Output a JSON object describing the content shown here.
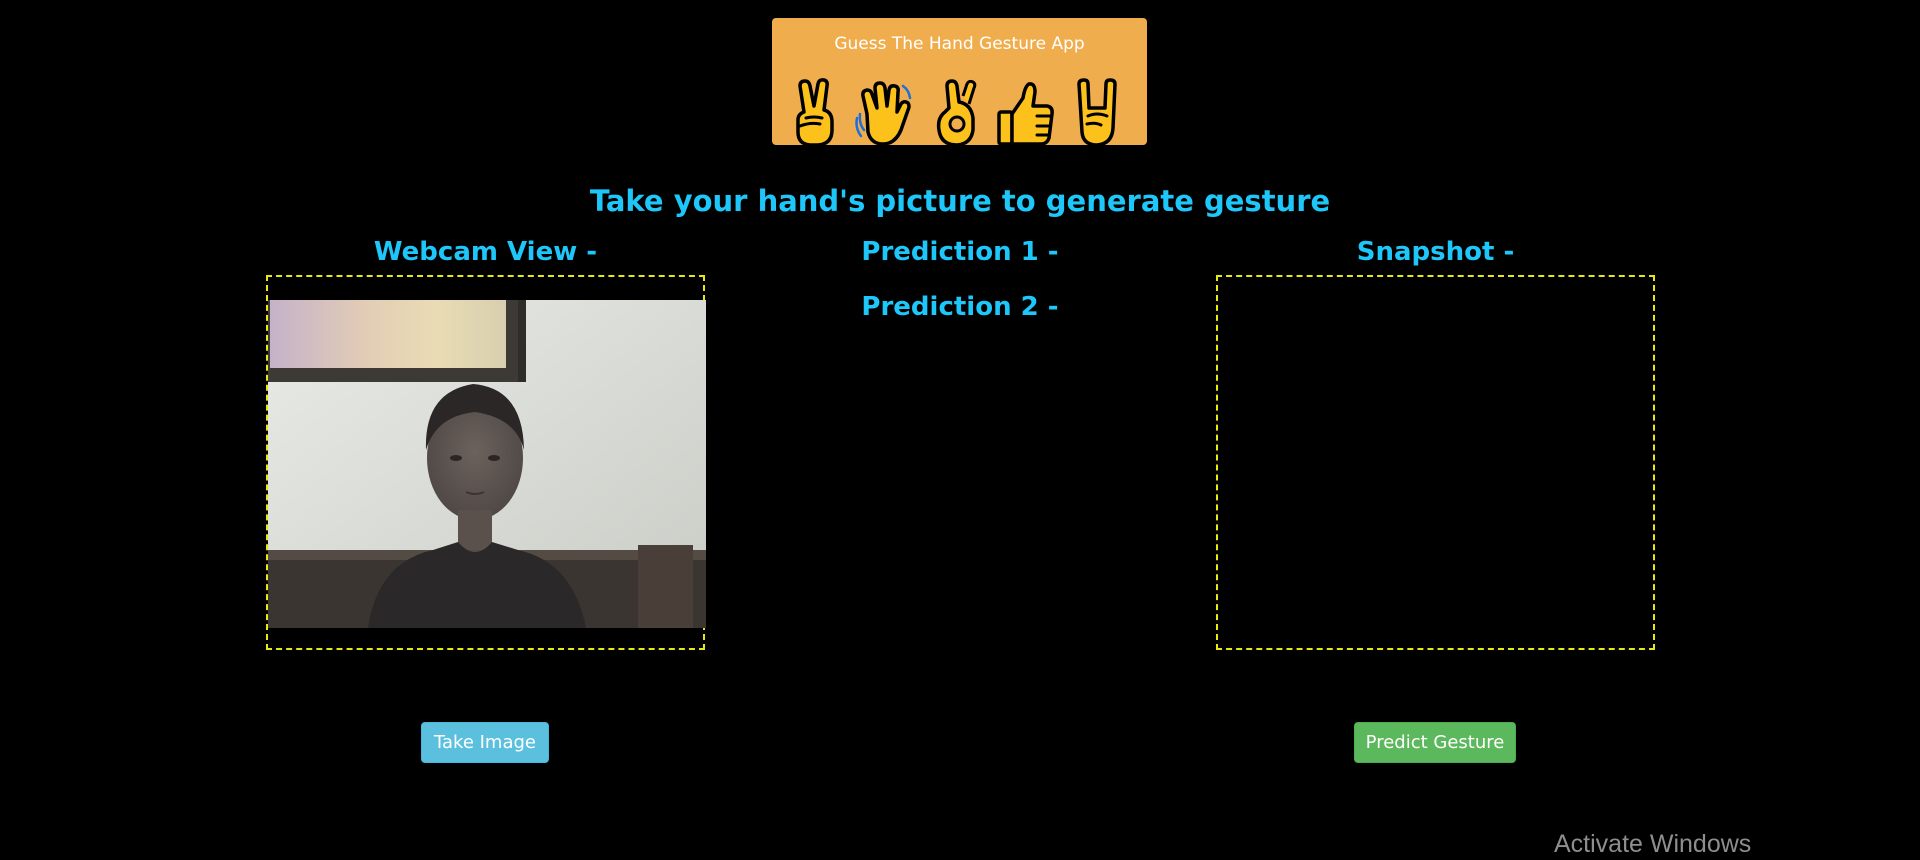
{
  "banner": {
    "title": "Guess The Hand Gesture App",
    "icons": [
      "victory-hand-icon",
      "waving-hand-icon",
      "ok-hand-icon",
      "thumbs-up-icon",
      "rock-on-hand-icon"
    ],
    "bg_color": "#f0ad4e"
  },
  "main": {
    "heading": "Take your hand's picture to generate gesture"
  },
  "webcam": {
    "label": "Webcam View -"
  },
  "predictions": {
    "prediction1": "Prediction 1 -",
    "prediction2": "Prediction 2 -"
  },
  "snapshot": {
    "label": "Snapshot -"
  },
  "buttons": {
    "take_image": "Take Image",
    "predict_gesture": "Predict Gesture"
  },
  "watermark": "Activate Windows",
  "colors": {
    "accent": "#1ec7fa",
    "frame_border": "#e8e813",
    "take_button": "#5bc0de",
    "predict_button": "#5cb85c"
  }
}
